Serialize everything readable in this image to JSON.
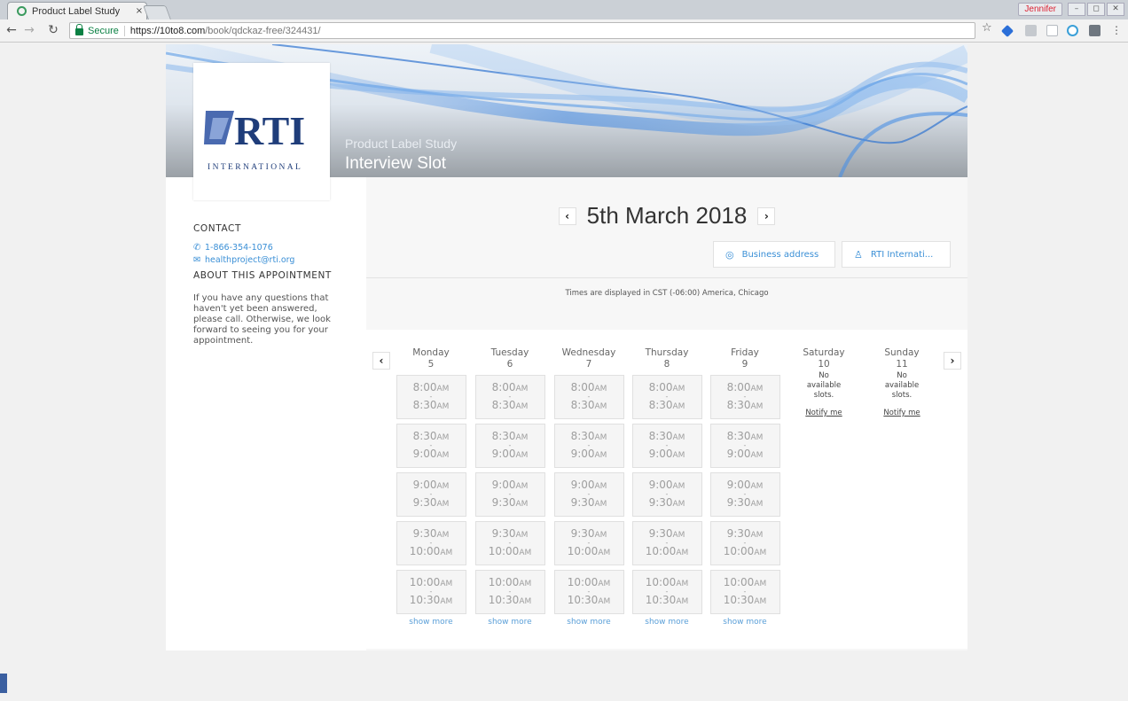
{
  "browser": {
    "tab_title": "Product Label Study",
    "tab_close": "×",
    "secure_label": "Secure",
    "url_host": "https://10to8.com",
    "url_path": "/book/qdckaz-free/324431/",
    "profile_name": "Jennifer"
  },
  "banner": {
    "logo_text": "RTI",
    "logo_sub": "INTERNATIONAL",
    "study_name": "Product Label Study",
    "page_title": "Interview Slot"
  },
  "sidebar": {
    "contact_heading": "CONTACT",
    "phone": "1-866-354-1076",
    "email": "healthproject@rti.org",
    "about_heading": "ABOUT THIS APPOINTMENT",
    "about_text": "If you have any questions that haven't yet been answered, please call. Otherwise, we look forward to seeing you for your appointment."
  },
  "main": {
    "date": "5th March 2018",
    "prev_icon": "chevron-left-icon",
    "next_icon": "chevron-right-icon",
    "location_label": "Business address",
    "staff_label": "RTI Internati...",
    "timezone_note": "Times are displayed in CST (-06:00) America, Chicago",
    "show_more": "show more",
    "no_slots": "No available slots.",
    "notify": "Notify me",
    "days": [
      {
        "name": "Monday",
        "num": "5"
      },
      {
        "name": "Tuesday",
        "num": "6"
      },
      {
        "name": "Wednesday",
        "num": "7"
      },
      {
        "name": "Thursday",
        "num": "8"
      },
      {
        "name": "Friday",
        "num": "9"
      },
      {
        "name": "Saturday",
        "num": "10"
      },
      {
        "name": "Sunday",
        "num": "11"
      }
    ],
    "slots": [
      {
        "start": "8:00",
        "end": "8:30"
      },
      {
        "start": "8:30",
        "end": "9:00"
      },
      {
        "start": "9:00",
        "end": "9:30"
      },
      {
        "start": "9:30",
        "end": "10:00"
      },
      {
        "start": "10:00",
        "end": "10:30"
      }
    ],
    "ampm": "AM",
    "dash": "-"
  },
  "colors": {
    "accent": "#3a8fd6",
    "secure_green": "#0b8043",
    "logo_blue": "#1f3d7a"
  }
}
